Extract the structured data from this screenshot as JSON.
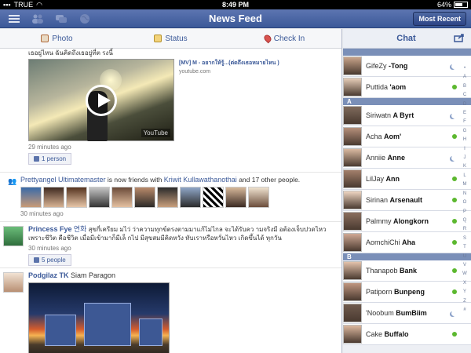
{
  "status_bar": {
    "carrier": "TRUE",
    "time": "8:49 PM",
    "battery": "64%",
    "battery_level": 0.64
  },
  "navbar": {
    "title": "News Feed",
    "most_recent_label": "Most Recent",
    "icons": [
      "menu-icon",
      "friends-icon",
      "messages-icon",
      "globe-icon"
    ]
  },
  "composer": {
    "photo": "Photo",
    "status": "Status",
    "checkin": "Check In"
  },
  "feed": {
    "video_story": {
      "text": "เธอยู่ไหน ฉันคิดถึงเธอยู่ที่ต รงนี้",
      "video_title": "[MV] M - อยากให้รู้...(ต่ดถึงเธอหมายไหน )",
      "video_domain": "youtube.com",
      "yt_badge": "YouTube",
      "time": "29 minutes ago",
      "likes": "1 person"
    },
    "friends_story": {
      "actor": "Prettyangel Ultimatemaster",
      "verb": "is now friends with",
      "friend": "Kriwit Kullawathanothai",
      "others": "and 17 other people.",
      "time": "30 minutes ago"
    },
    "thai_post": {
      "name": "Princess Fye",
      "name_suffix": "연화",
      "text": "สุขกี่เครียม มไว่ ว่าความทุกข์ตรงตามมาแก้ไม่ไกล จะได้รับคว ามจริงมี อต้องเจ็บปวดไหว เพราะชีวิต คือชีวิต เมื่อมีเข้ามาก็มีเล็ กไป มีสุขสมมีคิดหวัง ทับเราหรือหวั่นไหว เกิดขึ้นได้ ทุกวัน",
      "time": "30 minutes ago",
      "likes": "5 people"
    },
    "checkin_post": {
      "name": "Podgilaz TK",
      "place": "Siam Paragon"
    }
  },
  "chat": {
    "title": "Chat",
    "sections": [
      {
        "label": "",
        "contacts": [
          {
            "first": "GifeZy",
            "last": "-Tong",
            "status": "idle"
          },
          {
            "first": "Puttida",
            "last": "'aom",
            "status": "online"
          }
        ]
      },
      {
        "label": "A",
        "contacts": [
          {
            "first": "Siriwatn",
            "last": "A Byrt",
            "status": "idle"
          },
          {
            "first": "Acha",
            "last": "Aom'",
            "status": "online"
          },
          {
            "first": "Anniie",
            "last": "Anne",
            "status": "idle"
          },
          {
            "first": "LilJay",
            "last": "Ann",
            "status": "online"
          },
          {
            "first": "Sirinan",
            "last": "Arsenault",
            "status": "online"
          },
          {
            "first": "Palmmy",
            "last": "Alongkorn",
            "status": "online"
          },
          {
            "first": "AomchiChi",
            "last": "Aha",
            "status": "online"
          }
        ]
      },
      {
        "label": "B",
        "contacts": [
          {
            "first": "Thanapob",
            "last": "Bank",
            "status": "online"
          },
          {
            "first": "Patiporn",
            "last": "Bunpeng",
            "status": "online"
          },
          {
            "first": "'Noobum",
            "last": "BumBiim",
            "status": "idle"
          },
          {
            "first": "Cake",
            "last": "Buffalo",
            "status": "online"
          }
        ]
      }
    ],
    "alphabet": [
      "•",
      "A",
      "B",
      "C",
      "D",
      "E",
      "F",
      "G",
      "H",
      "I",
      "J",
      "K",
      "L",
      "M",
      "N",
      "O",
      "P",
      "Q",
      "R",
      "S",
      "T",
      "U",
      "V",
      "W",
      "X",
      "Y",
      "Z",
      "#"
    ]
  }
}
